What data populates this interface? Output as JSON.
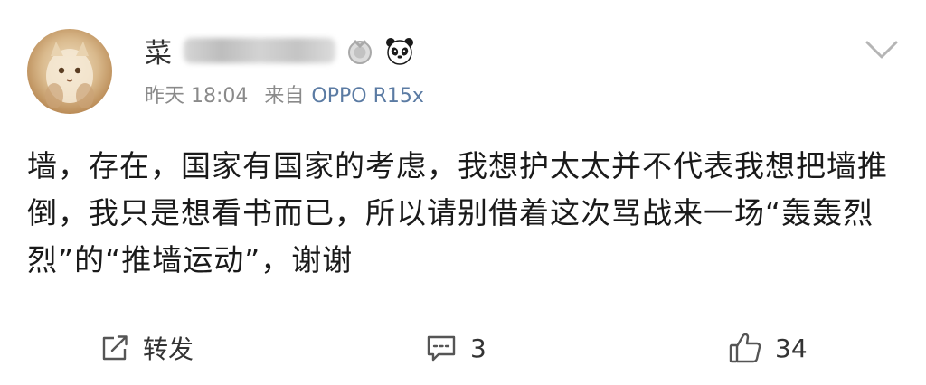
{
  "post": {
    "username_visible": "菜",
    "timestamp": "昨天 18:04",
    "source_prefix": "来自",
    "source_name": "OPPO R15x",
    "body": "墙，存在，国家有国家的考虑，我想护太太并不代表我想把墙推倒，我只是想看书而已，所以请别借着这次骂战来一场“轰轰烈烈”的“推墙运动”，谢谢"
  },
  "actions": {
    "repost_label": "转发",
    "comment_count": "3",
    "like_count": "34"
  },
  "icons": {
    "badge": "medal-badge-icon",
    "panda": "panda-emoji-icon",
    "menu": "chevron-down-icon",
    "repost": "repost-share-icon",
    "comment": "comment-bubble-icon",
    "like": "thumbs-up-icon"
  },
  "colors": {
    "text": "#1a1a1a",
    "meta_gray": "#8a8a8a",
    "source_blue": "#5b7ba3",
    "background": "#ffffff"
  }
}
